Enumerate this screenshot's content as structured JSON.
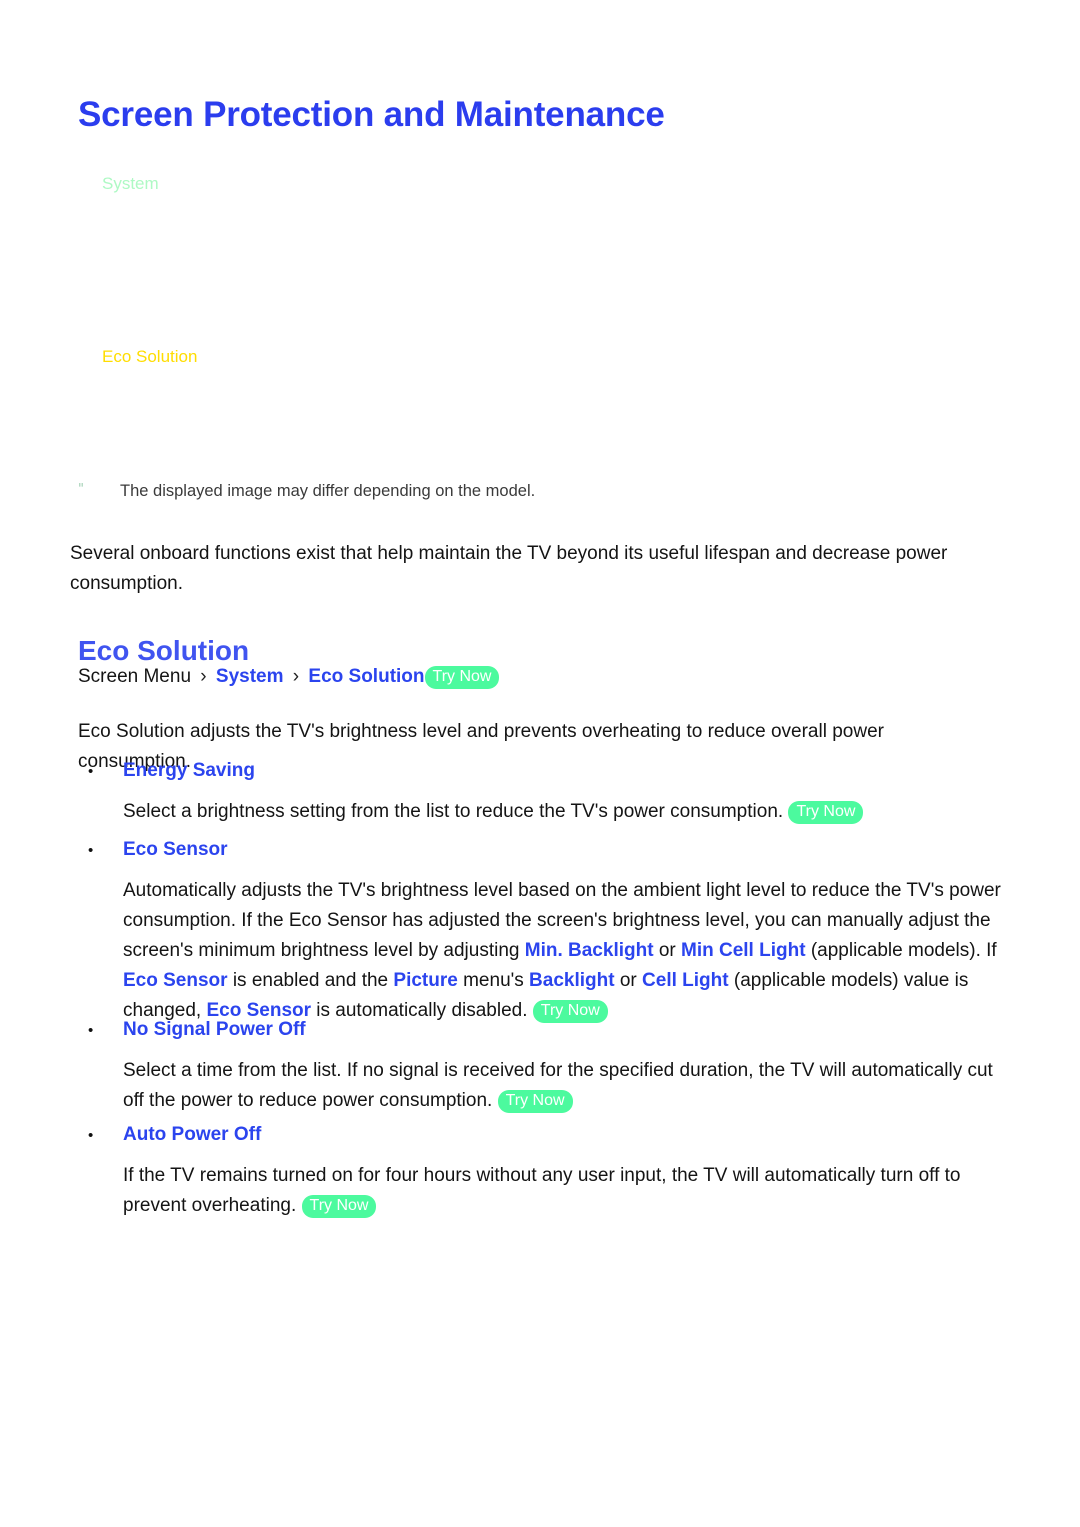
{
  "document": {
    "title": "Screen Protection and Maintenance"
  },
  "menu_mock": {
    "system_label": "System",
    "eco_solution_label": "Eco Solution"
  },
  "note": {
    "marker": "\"",
    "text": "The displayed image may differ depending on the model."
  },
  "intro": {
    "paragraph": "Several onboard functions exist that help maintain the TV beyond its useful lifespan and decrease power consumption."
  },
  "section": {
    "heading": "Eco Solution",
    "breadcrumb": {
      "root": "Screen Menu",
      "sep": "›",
      "item1": "System",
      "item2": "Eco Solution",
      "try_now": "Try Now"
    },
    "description": "Eco Solution adjusts the TV's brightness level and prevents overheating to reduce overall power consumption."
  },
  "bullets": [
    {
      "marker": "•",
      "label": "Energy Saving",
      "body_text_1": "Select a brightness setting from the list to reduce the TV's power consumption.",
      "try_now": "Try Now"
    },
    {
      "marker": "•",
      "label": "Eco Sensor",
      "body_text_1": "Automatically adjusts the TV's brightness level based on the ambient light level to reduce the TV's power consumption. If the Eco Sensor has adjusted the screen's brightness level, you can manually adjust the screen's minimum brightness level by adjusting ",
      "term_1": "Min. Backlight",
      "body_text_2": " or ",
      "term_2": "Min Cell Light",
      "body_text_3": " (applicable models). If ",
      "term_3": "Eco Sensor",
      "body_text_4": " is enabled and the ",
      "term_4": "Picture",
      "body_text_5": " menu's ",
      "term_5": "Backlight",
      "body_text_6": " or ",
      "term_6": "Cell Light",
      "body_text_7": " (applicable models) value is changed, ",
      "term_7": "Eco Sensor",
      "body_text_8": " is automatically disabled. ",
      "try_now": "Try Now"
    },
    {
      "marker": "•",
      "label": "No Signal Power Off",
      "body_text_1": "Select a time from the list. If no signal is received for the specified duration, the TV will automatically cut off the power to reduce power consumption.",
      "try_now": "Try Now"
    },
    {
      "marker": "•",
      "label": "Auto Power Off",
      "body_text_1": "If the TV remains turned on for four hours without any user input, the TV will automatically turn off to prevent overheating.",
      "try_now": "Try Now"
    }
  ],
  "colors": {
    "title_blue": "#2B3DEE",
    "heading_blue": "#4054F0",
    "link_blue": "#2B44EE",
    "try_now_green": "#4CFA9E",
    "mock_system_green": "#AEF9C4",
    "mock_eco_yellow": "#FFDD00",
    "body_black": "#141414",
    "page_background": "#FFFFFF"
  }
}
